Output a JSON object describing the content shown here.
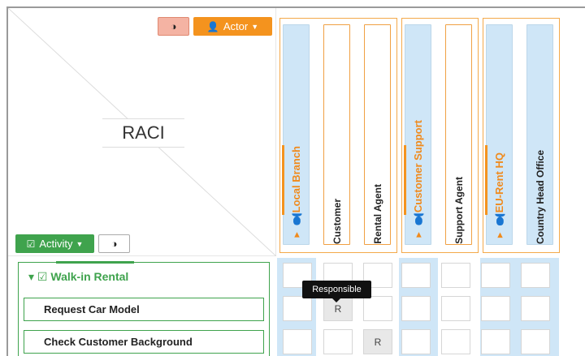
{
  "header": {
    "title": "RACI"
  },
  "toolbar": {
    "contrast_icon": "contrast-icon",
    "actor_label": "Actor",
    "activity_label": "Activity"
  },
  "actors": [
    {
      "label": "Local Branch",
      "kind": "group"
    },
    {
      "label": "Customer",
      "kind": "role"
    },
    {
      "label": "Rental Agent",
      "kind": "role"
    },
    {
      "label": "Customer Support",
      "kind": "group"
    },
    {
      "label": "Support Agent",
      "kind": "role"
    },
    {
      "label": "EU-Rent HQ",
      "kind": "group"
    },
    {
      "label": "Country Head Office",
      "kind": "role"
    }
  ],
  "activities": {
    "group": "Walk-in Rental",
    "items": [
      {
        "label": "Request Car Model"
      },
      {
        "label": "Check Customer Background"
      }
    ]
  },
  "matrix": {
    "rows": [
      [
        "",
        "",
        "",
        "",
        "",
        "",
        ""
      ],
      [
        "",
        "R",
        "",
        "",
        "",
        "",
        ""
      ],
      [
        "",
        "",
        "R",
        "",
        "",
        "",
        ""
      ]
    ]
  },
  "tooltip": {
    "text": "Responsible"
  },
  "colors": {
    "accent": "#f4931e",
    "activity": "#3fa34d",
    "group_bg": "#cfe6f7"
  }
}
